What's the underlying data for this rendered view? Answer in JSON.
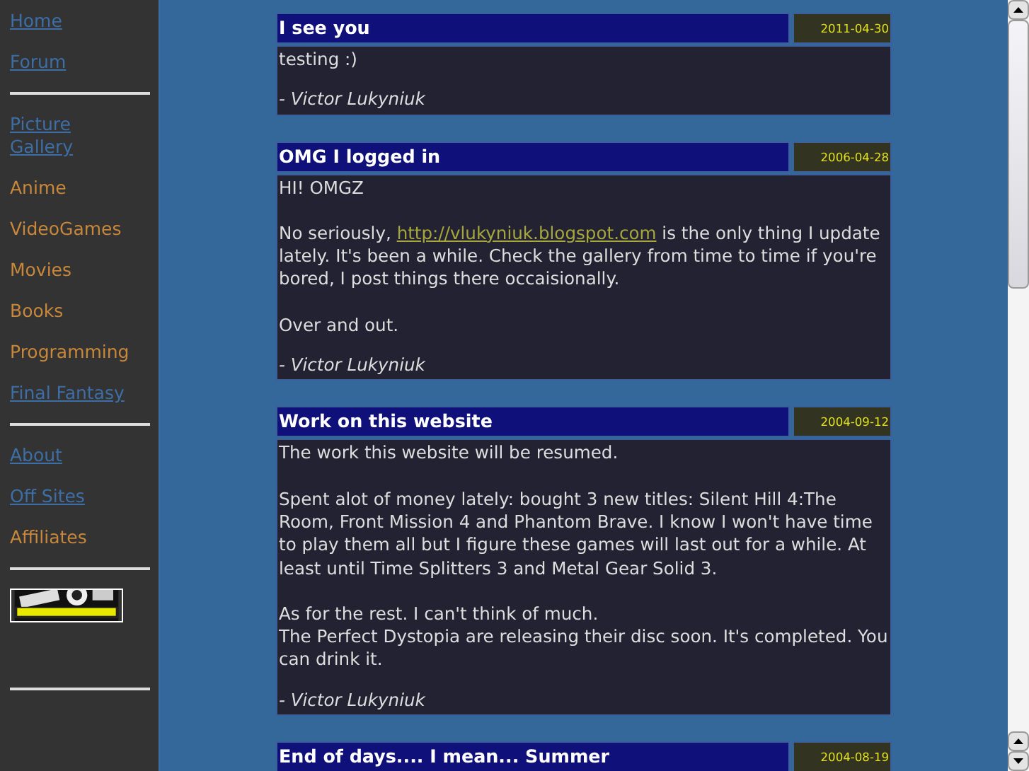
{
  "sidebar": {
    "groups": [
      {
        "items": [
          {
            "label": "Home",
            "kind": "link"
          },
          {
            "label": "Forum",
            "kind": "link"
          }
        ]
      },
      {
        "items": [
          {
            "label": "Picture Gallery",
            "kind": "link"
          },
          {
            "label": "Anime",
            "kind": "plain"
          },
          {
            "label": "VideoGames",
            "kind": "plain"
          },
          {
            "label": "Movies",
            "kind": "plain"
          },
          {
            "label": "Books",
            "kind": "plain"
          },
          {
            "label": "Programming",
            "kind": "plain"
          },
          {
            "label": "Final Fantasy",
            "kind": "link"
          }
        ]
      },
      {
        "items": [
          {
            "label": "About",
            "kind": "link"
          },
          {
            "label": "Off Sites",
            "kind": "link"
          },
          {
            "label": "Affiliates",
            "kind": "plain"
          }
        ]
      },
      {
        "items": [
          {
            "kind": "banner"
          }
        ]
      }
    ]
  },
  "posts": [
    {
      "title": "I see you",
      "date": "2011-04-30",
      "paragraphs": [
        {
          "lines": [
            "testing :)"
          ]
        }
      ],
      "author": "- Victor Lukyniuk"
    },
    {
      "title": "OMG I logged in",
      "date": "2006-04-28",
      "paragraphs": [
        {
          "lines": [
            "HI! OMGZ"
          ]
        },
        {
          "before": "No seriously, ",
          "link": "http://vlukyniuk.blogspot.com",
          "after": " is the only thing I update lately. It's been a while. Check the gallery from time to time if you're bored, I post things there occaisionally."
        },
        {
          "lines": [
            "Over and out."
          ]
        }
      ],
      "author": "- Victor Lukyniuk"
    },
    {
      "title": "Work on this website",
      "date": "2004-09-12",
      "paragraphs": [
        {
          "lines": [
            "The work this website will be resumed."
          ]
        },
        {
          "lines": [
            "Spent alot of money lately: bought 3 new titles: Silent Hill 4:The Room, Front Mission 4 and Phantom Brave. I know I won't have time to play them all but I figure these games will last out for a while. At least until Time Splitters 3 and Metal Gear Solid 3."
          ]
        },
        {
          "lines": [
            "As for the rest. I can't think of much.",
            "The Perfect Dystopia are releasing their disc soon. It's completed. You can drink it."
          ]
        }
      ],
      "author": "- Victor Lukyniuk"
    },
    {
      "title": "End of days.... I mean... Summer",
      "date": "2004-08-19"
    }
  ]
}
